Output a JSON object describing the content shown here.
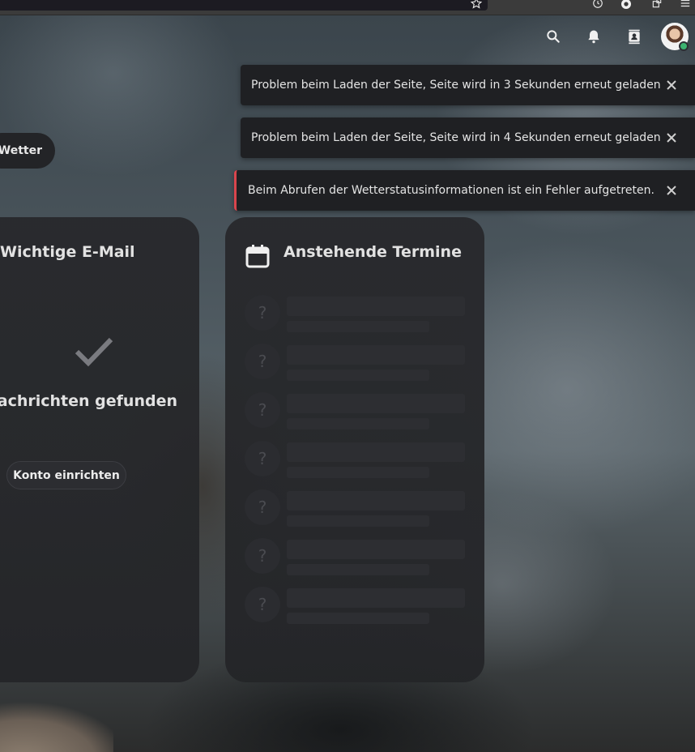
{
  "topbar": {
    "icons": [
      "search-icon",
      "bell-icon",
      "contacts-icon"
    ],
    "status_color": "#3cb371"
  },
  "toasts": [
    {
      "message": "Problem beim Laden der Seite, Seite wird in 3 Sekunden erneut geladen",
      "type": "warning"
    },
    {
      "message": "Problem beim Laden der Seite, Seite wird in 4 Sekunden erneut geladen",
      "type": "warning"
    },
    {
      "message": "Beim Abrufen der Wetterstatusinformationen ist ein Fehler aufgetreten.",
      "type": "error",
      "accent": "#d9454d"
    }
  ],
  "weather": {
    "label": "Wetter"
  },
  "email_card": {
    "title": "Wichtige E-Mail",
    "empty_message": "e Nachrichten gefunden",
    "setup_button": "Konto einrichten"
  },
  "events_card": {
    "title": "Anstehende Termine",
    "placeholder_glyph": "?",
    "skeleton_count": 7
  }
}
